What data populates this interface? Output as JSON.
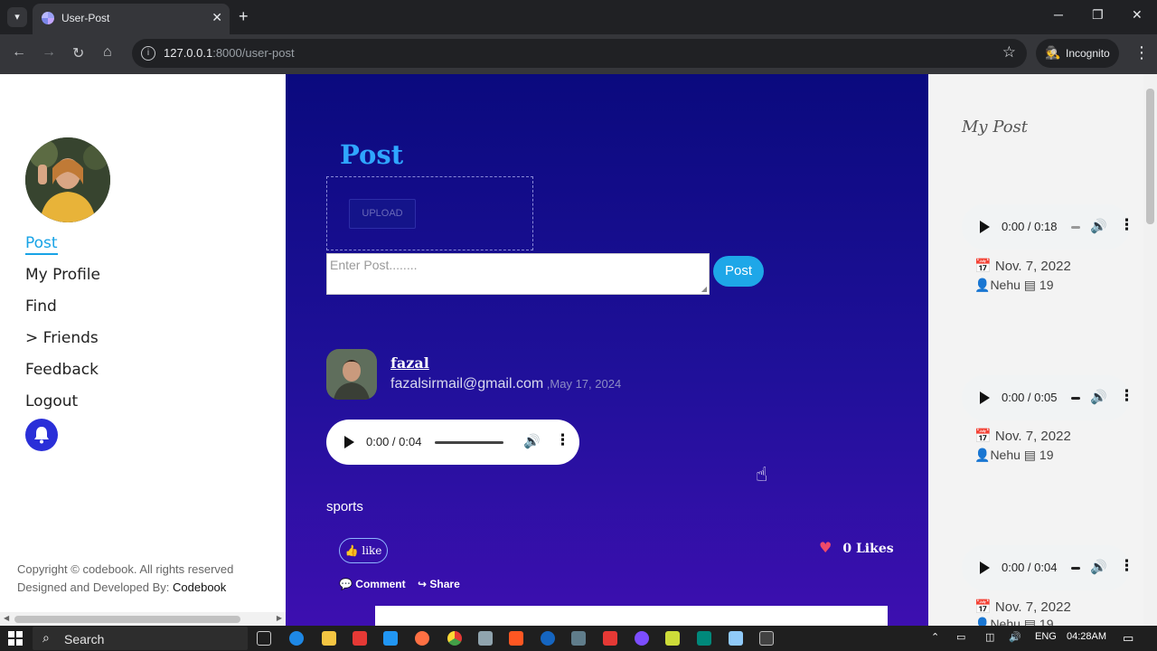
{
  "browser": {
    "tab_title": "User-Post",
    "tab_close": "✕",
    "new_tab": "+",
    "url_host": "127.0.0.1",
    "url_rest": ":8000/user-post",
    "incognito_label": "Incognito",
    "window_controls": [
      "─",
      "❐",
      "✕"
    ]
  },
  "sidebar": {
    "nav": [
      {
        "label": "Post",
        "active": true
      },
      {
        "label": "My Profile"
      },
      {
        "label": "Find"
      },
      {
        "label": "> Friends"
      },
      {
        "label": "Feedback"
      },
      {
        "label": "Logout"
      }
    ],
    "footer_line1": "Copyright © codebook. All rights reserved",
    "footer_line2_prefix": "Designed and Developed By: ",
    "footer_line2_link": "Codebook"
  },
  "composer": {
    "heading": "Post",
    "upload_label": "UPLOAD",
    "input_placeholder": "Enter Post........",
    "submit_label": "Post"
  },
  "feed_post": {
    "author": "fazal",
    "email": "fazalsirmail@gmail.com",
    "date": " ,May 17, 2024",
    "audio_time": "0:00 / 0:04",
    "tag": "sports",
    "like_label": "like",
    "likes_text": "0 Likes",
    "comment_label": "Comment",
    "share_label": "Share"
  },
  "my_posts": {
    "title": "My Post",
    "items": [
      {
        "time": "0:00 / 0:18",
        "date": "Nov. 7, 2022",
        "user": "Nehu",
        "count": "19"
      },
      {
        "time": "0:00 / 0:05",
        "date": "Nov. 7, 2022",
        "user": "Nehu",
        "count": "19"
      },
      {
        "time": "0:00 / 0:04",
        "date": "Nov. 7, 2022",
        "user": "Nehu",
        "count": "19"
      }
    ]
  },
  "taskbar": {
    "search_label": "Search",
    "lang": "ENG",
    "clock": "04:28AM"
  },
  "colors": {
    "accent": "#18a3e6",
    "feed_top": "#0a0a7e",
    "feed_bottom": "#3d0fb0",
    "bell": "#2a2fd8"
  }
}
